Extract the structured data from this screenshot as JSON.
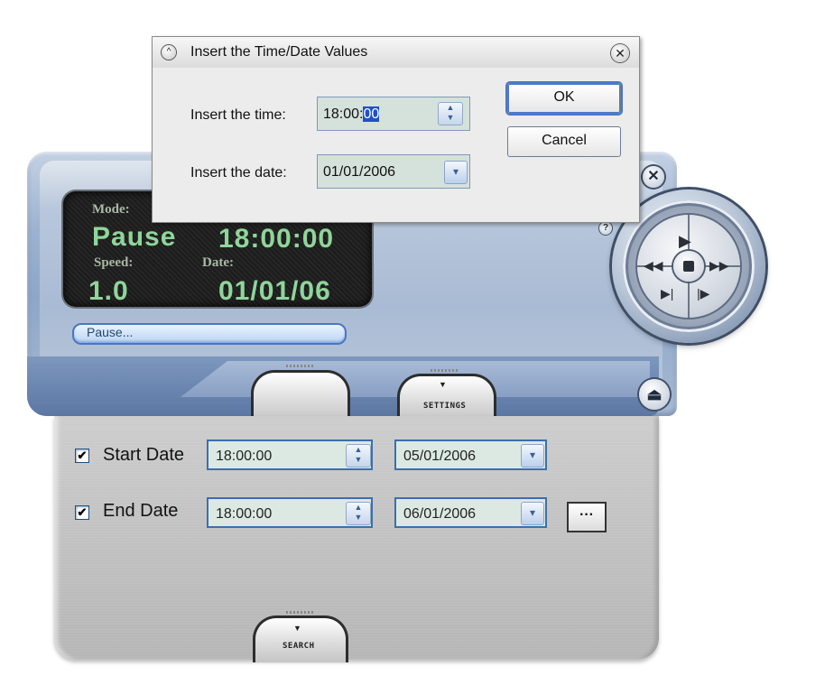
{
  "dialog": {
    "title": "Insert the Time/Date Values",
    "time_label": "Insert the time:",
    "time_value_prefix": "18:00:",
    "time_value_selected": "00",
    "date_label": "Insert the date:",
    "date_value": "01/01/2006",
    "ok_label": "OK",
    "cancel_label": "Cancel"
  },
  "display": {
    "mode_label": "Mode:",
    "mode_value": "Pause",
    "time_value": "18:00:00",
    "speed_label": "Speed:",
    "speed_value": "1.0",
    "date_label": "Date:",
    "date_value": "01/01/06"
  },
  "status": {
    "text": "Pause..."
  },
  "tabs": {
    "settings_label": "SETTINGS",
    "search_label": "SEARCH"
  },
  "settings": {
    "start": {
      "checked": true,
      "label": "Start Date",
      "time": "18:00:00",
      "date": "05/01/2006"
    },
    "end": {
      "checked": true,
      "label": "End Date",
      "time": "18:00:00",
      "date": "06/01/2006"
    },
    "more_label": "···"
  },
  "icons": {
    "check": "✔",
    "spin_up": "▲",
    "spin_down": "▼",
    "dropdown": "▾",
    "close": "✕",
    "collapse": "^",
    "help": "?",
    "eject": "⏏",
    "play": "▶",
    "rewind": "◀◀",
    "forward": "▶▶",
    "prev": "▶|",
    "next": "|▶"
  },
  "colors": {
    "lcd_text": "#8fd59a",
    "accent_blue": "#4a78c0",
    "panel_grey": "#bdbdbd"
  }
}
